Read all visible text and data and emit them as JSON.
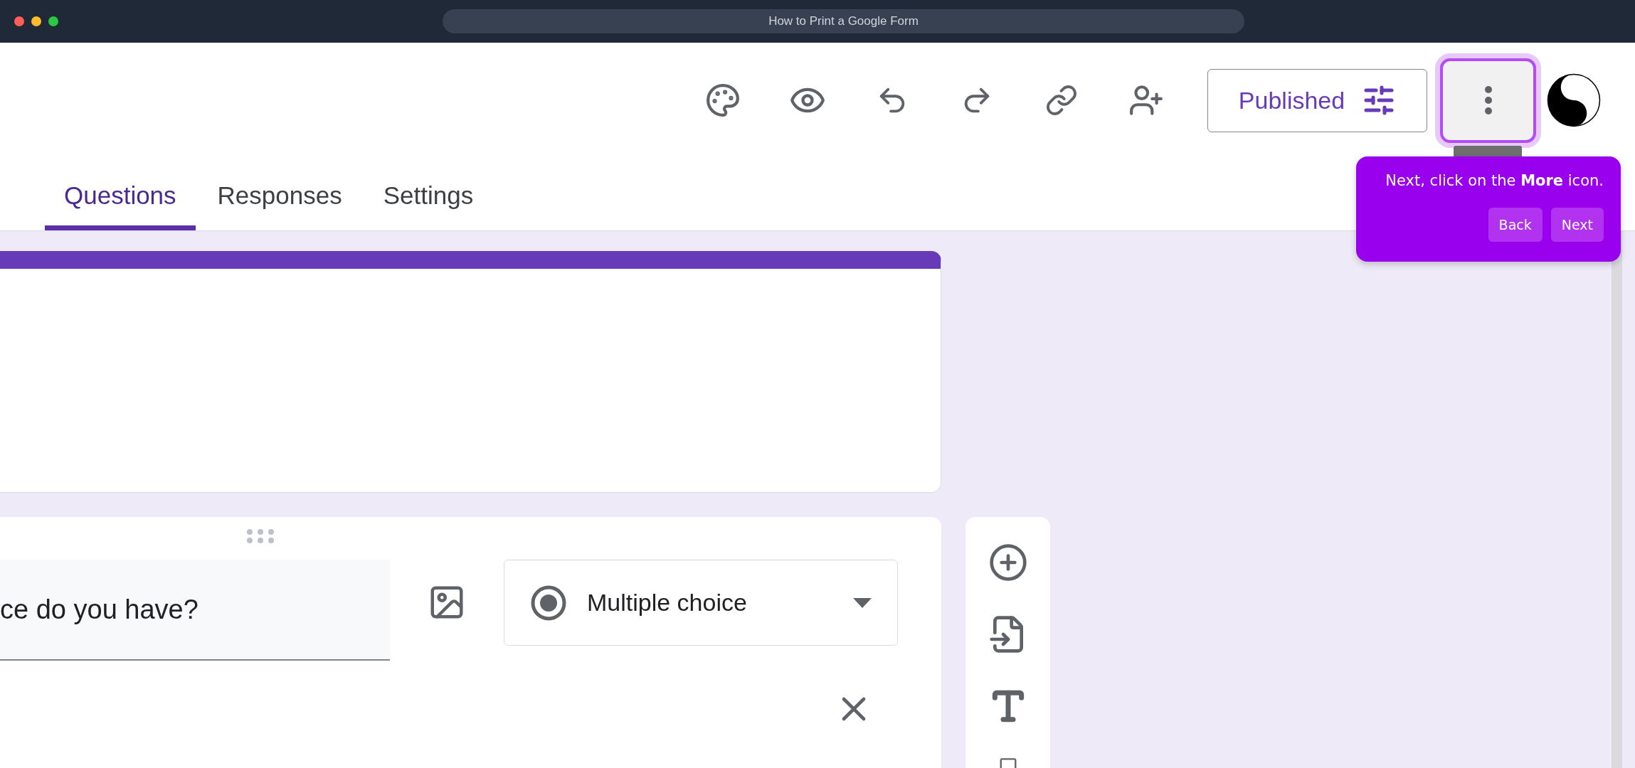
{
  "window": {
    "title": "How to Print a Google Form"
  },
  "toolbar": {
    "publish_button": "Published"
  },
  "tabs": [
    {
      "label": "Questions",
      "selected": true
    },
    {
      "label": "Responses",
      "selected": false
    },
    {
      "label": "Settings",
      "selected": false
    }
  ],
  "question": {
    "title": "ce do you have?",
    "type": "Multiple choice"
  },
  "guide": {
    "text": "Next, click on the **More** icon.",
    "buttons": [
      "Back",
      "Next"
    ]
  }
}
